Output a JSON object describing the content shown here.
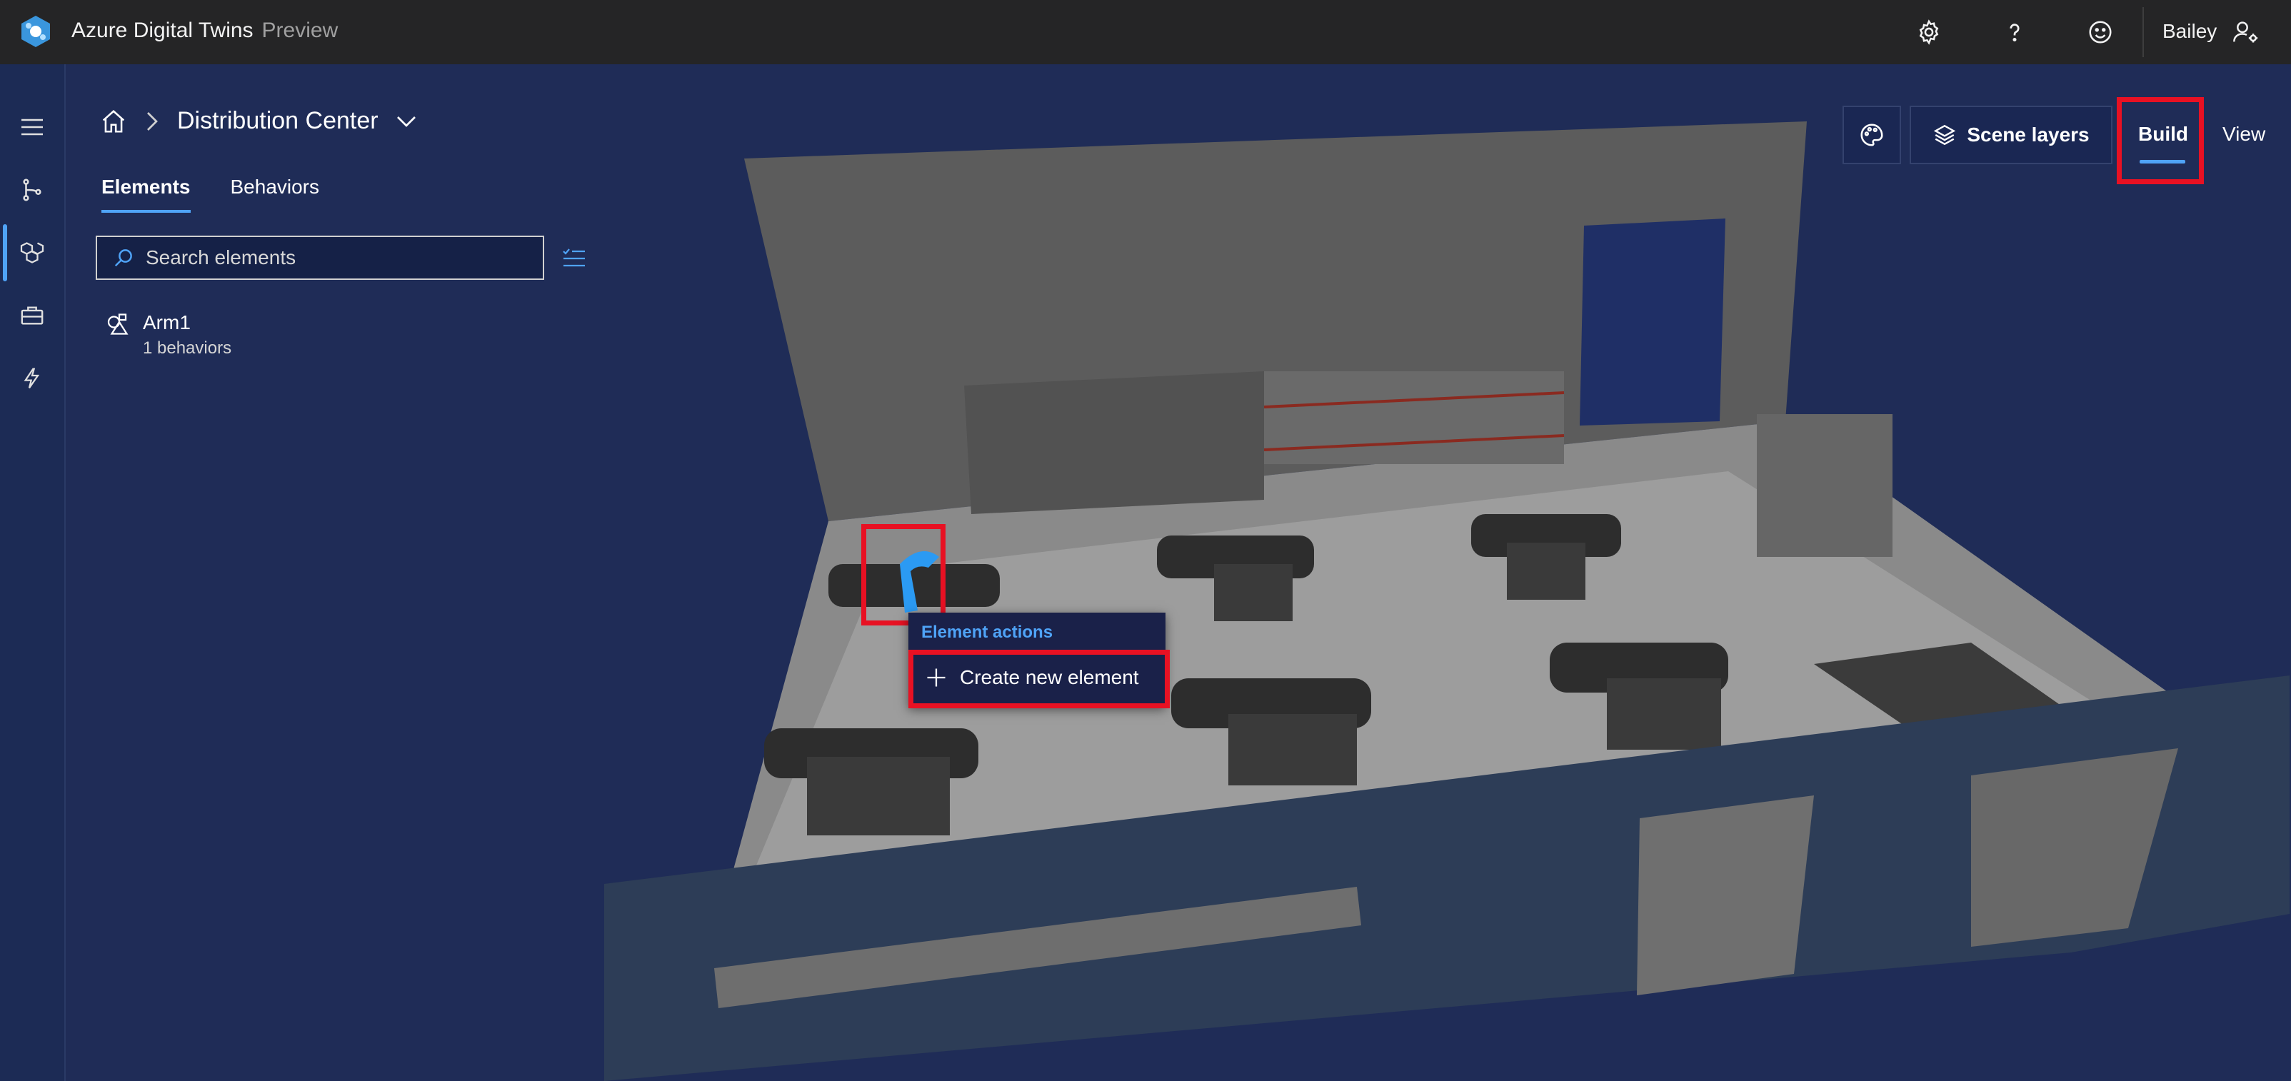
{
  "app": {
    "title": "Azure Digital Twins",
    "badge": "Preview"
  },
  "user": {
    "name": "Bailey"
  },
  "breadcrumb": {
    "scene_name": "Distribution Center"
  },
  "panel": {
    "tabs": [
      {
        "label": "Elements",
        "active": true
      },
      {
        "label": "Behaviors",
        "active": false
      }
    ],
    "search_placeholder": "Search elements",
    "elements": [
      {
        "name": "Arm1",
        "subtitle": "1 behaviors"
      }
    ]
  },
  "toolbar": {
    "scene_layers_label": "Scene layers",
    "modes": [
      {
        "label": "Build",
        "active": true
      },
      {
        "label": "View",
        "active": false
      }
    ]
  },
  "context_menu": {
    "title": "Element actions",
    "items": [
      {
        "label": "Create new element",
        "icon": "plus-icon"
      }
    ]
  },
  "colors": {
    "accent": "#4fa3f7",
    "highlight": "#e81123",
    "topbar": "#252526",
    "background": "#1f2c57"
  }
}
